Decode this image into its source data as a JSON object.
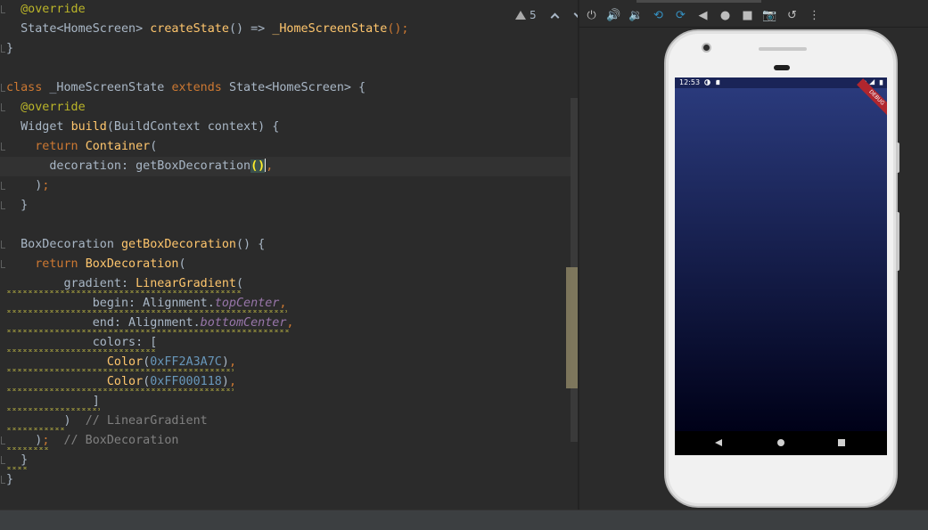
{
  "editor": {
    "warnings": {
      "count": "5"
    },
    "lines": [
      {
        "top": 0,
        "spans": [
          [
            "ann",
            "  @override"
          ]
        ]
      },
      {
        "spans": [
          [
            "cls",
            "  State<HomeScreen> "
          ],
          [
            "fn",
            "createState"
          ],
          [
            "cls",
            "() => "
          ],
          [
            "fn",
            "_HomeScreenState"
          ],
          [
            "kw",
            "();"
          ]
        ]
      },
      {
        "spans": [
          [
            "cls",
            "}"
          ]
        ]
      },
      {
        "spans": [
          [
            "cls",
            ""
          ]
        ]
      },
      {
        "spans": [
          [
            "kw",
            "class "
          ],
          [
            "cls",
            "_HomeScreenState "
          ],
          [
            "kw",
            "extends "
          ],
          [
            "cls",
            "State<HomeScreen> {"
          ]
        ]
      },
      {
        "spans": [
          [
            "ann",
            "  @override"
          ]
        ]
      },
      {
        "spans": [
          [
            "cls",
            "  Widget "
          ],
          [
            "fn",
            "build"
          ],
          [
            "cls",
            "(BuildContext context) {"
          ]
        ]
      },
      {
        "spans": [
          [
            "kw",
            "    return "
          ],
          [
            "fn",
            "Container"
          ],
          [
            "cls",
            "("
          ]
        ]
      },
      {
        "spans": [
          [
            "cls",
            "      decoration: getBoxDecoration"
          ],
          [
            "hl",
            "()"
          ],
          [
            "caret",
            ""
          ],
          [
            "kw",
            ","
          ]
        ]
      },
      {
        "spans": [
          [
            "cls",
            "    )"
          ],
          [
            "kw",
            ";"
          ]
        ]
      },
      {
        "spans": [
          [
            "cls",
            "  }"
          ]
        ]
      },
      {
        "spans": [
          [
            "cls",
            ""
          ]
        ]
      },
      {
        "spans": [
          [
            "cls",
            "  BoxDecoration "
          ],
          [
            "fn",
            "getBoxDecoration"
          ],
          [
            "cls",
            "() {"
          ]
        ]
      },
      {
        "spans": [
          [
            "kw",
            "    return "
          ],
          [
            "fn",
            "BoxDecoration"
          ],
          [
            "cls",
            "("
          ]
        ]
      },
      {
        "spans": [
          [
            "cls",
            "        gradient: "
          ],
          [
            "fn",
            "LinearGradient"
          ],
          [
            "cls",
            "("
          ]
        ]
      },
      {
        "spans": [
          [
            "cls",
            "            begin: Alignment."
          ],
          [
            "it",
            "topCenter"
          ],
          [
            "kw",
            ","
          ]
        ]
      },
      {
        "spans": [
          [
            "cls",
            "            end: Alignment."
          ],
          [
            "it",
            "bottomCenter"
          ],
          [
            "kw",
            ","
          ]
        ]
      },
      {
        "spans": [
          [
            "cls",
            "            colors: ["
          ]
        ]
      },
      {
        "spans": [
          [
            "fn",
            "              Color"
          ],
          [
            "cls",
            "("
          ],
          [
            "num",
            "0xFF2A3A7C"
          ],
          [
            "cls",
            ")"
          ],
          [
            "kw",
            ","
          ]
        ]
      },
      {
        "spans": [
          [
            "fn",
            "              Color"
          ],
          [
            "cls",
            "("
          ],
          [
            "num",
            "0xFF000118"
          ],
          [
            "cls",
            ")"
          ],
          [
            "kw",
            ","
          ]
        ]
      },
      {
        "spans": [
          [
            "cls",
            "            ]"
          ]
        ]
      },
      {
        "spans": [
          [
            "cls",
            "        )  "
          ],
          [
            "cmt",
            "// LinearGradient"
          ]
        ]
      },
      {
        "spans": [
          [
            "cls",
            "    )"
          ],
          [
            "kw",
            ";  "
          ],
          [
            "cmt",
            "// BoxDecoration"
          ]
        ]
      },
      {
        "spans": [
          [
            "cls",
            "  }"
          ]
        ]
      },
      {
        "spans": [
          [
            "cls",
            "}"
          ]
        ]
      }
    ]
  },
  "emulator": {
    "toolbar": [
      {
        "name": "power-icon",
        "glyph": "⏻"
      },
      {
        "name": "volume-up-icon",
        "glyph": "🔊"
      },
      {
        "name": "volume-down-icon",
        "glyph": "🔉"
      },
      {
        "name": "rotate-left-icon",
        "glyph": "⟲"
      },
      {
        "name": "rotate-right-icon",
        "glyph": "⟳"
      },
      {
        "name": "back-icon",
        "glyph": "◀"
      },
      {
        "name": "home-icon",
        "glyph": "●"
      },
      {
        "name": "overview-icon",
        "glyph": "■"
      },
      {
        "name": "screenshot-icon",
        "glyph": "📷"
      },
      {
        "name": "restore-icon",
        "glyph": "↺"
      },
      {
        "name": "more-icon",
        "glyph": "⋮"
      }
    ],
    "status_time": "12:53",
    "debug_label": "DEBUG",
    "gradient": {
      "top": "#2a3a7c",
      "bottom": "#000118"
    }
  }
}
